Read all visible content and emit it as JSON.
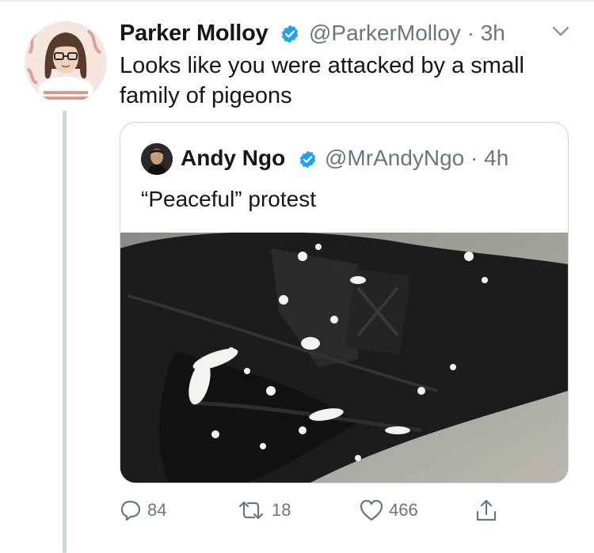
{
  "tweet": {
    "author_name": "Parker Molloy",
    "handle": "@ParkerMolloy",
    "separator": "·",
    "time": "3h",
    "text": "Looks like you were attacked by a small family of pigeons"
  },
  "quoted": {
    "author_name": "Andy Ngo",
    "handle": "@MrAndyNgo",
    "separator": "·",
    "time": "4h",
    "text": "“Peaceful” protest"
  },
  "actions": {
    "replies": "84",
    "retweets": "18",
    "likes": "466"
  },
  "colors": {
    "verified": "#1da1f2",
    "secondary_text": "#657786",
    "border": "#ccd6dd"
  },
  "icons": [
    "verified-badge-icon",
    "chevron-down-icon",
    "reply-icon",
    "retweet-icon",
    "like-icon",
    "share-icon"
  ]
}
